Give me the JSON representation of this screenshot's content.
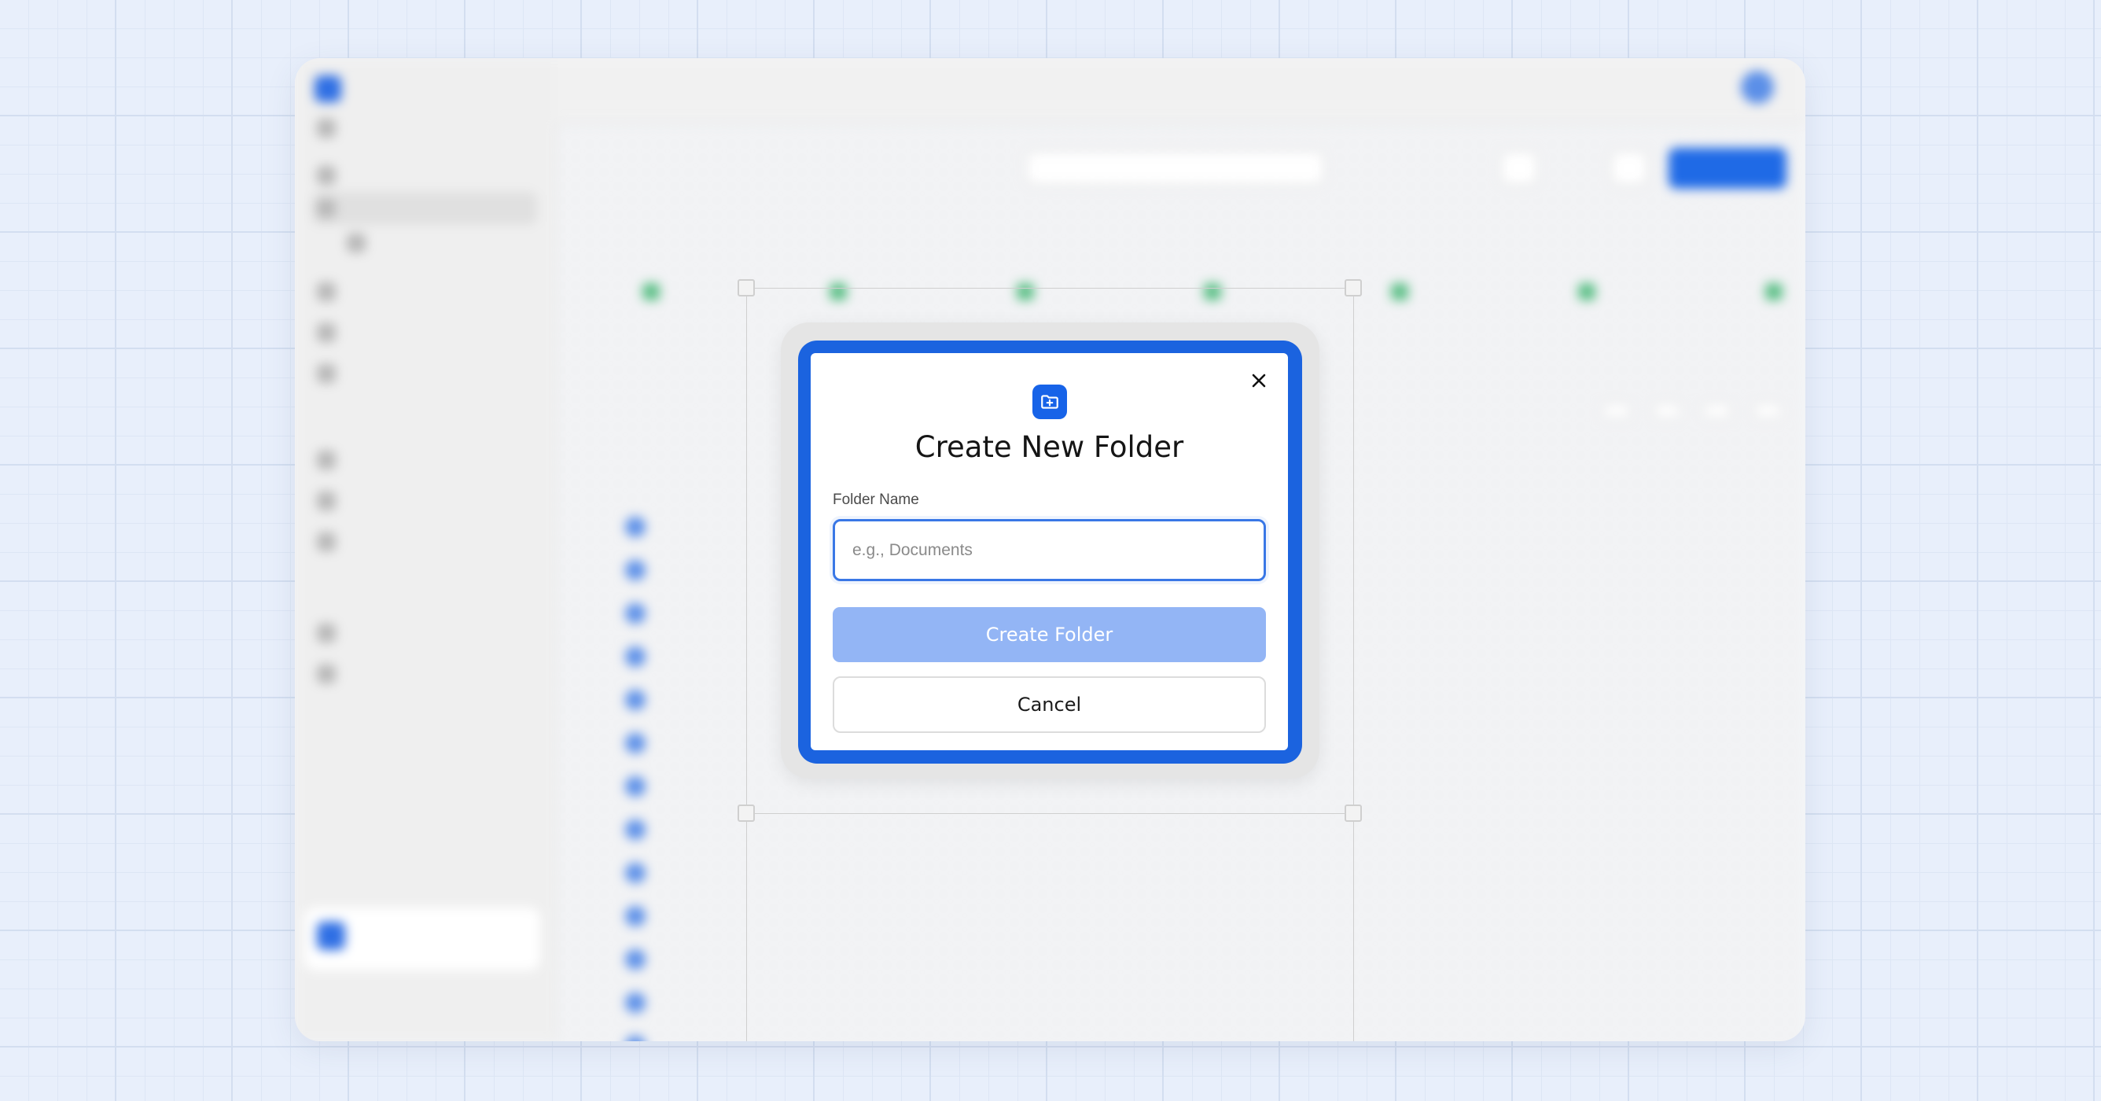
{
  "dialog": {
    "title": "Create New Folder",
    "field_label": "Folder Name",
    "input_value": "",
    "input_placeholder": "e.g., Documents",
    "primary_button": "Create Folder",
    "secondary_button": "Cancel",
    "icon": "folder-plus-icon",
    "close_icon": "close-icon",
    "primary_enabled": false
  },
  "colors": {
    "accent": "#1763e8",
    "frame": "#1b63df",
    "primary_disabled": "#93b5f5",
    "input_border": "#3977e6",
    "page_bg": "#e8effb"
  }
}
